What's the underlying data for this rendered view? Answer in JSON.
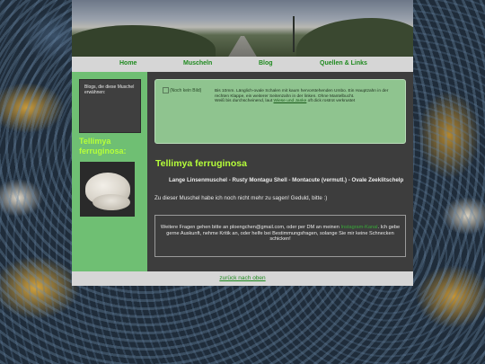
{
  "nav": {
    "items": [
      {
        "label": "Home"
      },
      {
        "label": "Muscheln"
      },
      {
        "label": "Blog"
      },
      {
        "label": "Quellen & Links"
      }
    ]
  },
  "sidebar": {
    "blog_text": "Blogs, die diese Muschel erwähnen:",
    "blog_links": "",
    "species_title": "Tellimya ferruginosa:"
  },
  "info_box": {
    "image_alt": "(Noch kein Bild)",
    "description": "Bis 10mm. Länglich-ovale Schalen mit kaum hervorstehenden Umbo. Ein Hauptzahn in der rechten Klappe, ein weiterer Seitenzahn in der linken. Ohne Mantelbucht.",
    "color_prefix": "Weiß bis durchscheinend, laut ",
    "color_link": "Wiese und Janke",
    "color_suffix": " oft dick rostrot verkrustet"
  },
  "main": {
    "heading": "Tellimya ferruginosa",
    "common_names": "Lange Linsenmuschel - Rusty Montagu Shell - Montacute (vermutl.) - Ovale Zeeklitschelp",
    "status": "Zu dieser Muschel habe ich noch nicht mehr zu sagen! Geduld, bitte :)"
  },
  "contact": {
    "part1": "Weitere Fragen gehen bitte an ploengchen@gmail.com, oder per DM an meinen ",
    "link": "Instagram-Kanal",
    "part2": ". Ich gebe gerne Auskunft, nehme Kritik an, oder helfe bei Bestimmungsfragen, solange Sie mir keine Schnecken schicken!"
  },
  "footer": {
    "back_link": "zurück nach oben"
  },
  "colors": {
    "accent_green": "#6fbf73",
    "heading_lime": "#b6ff3a",
    "link_green": "#1f8a1f",
    "panel_dark": "#3d3d3d"
  }
}
